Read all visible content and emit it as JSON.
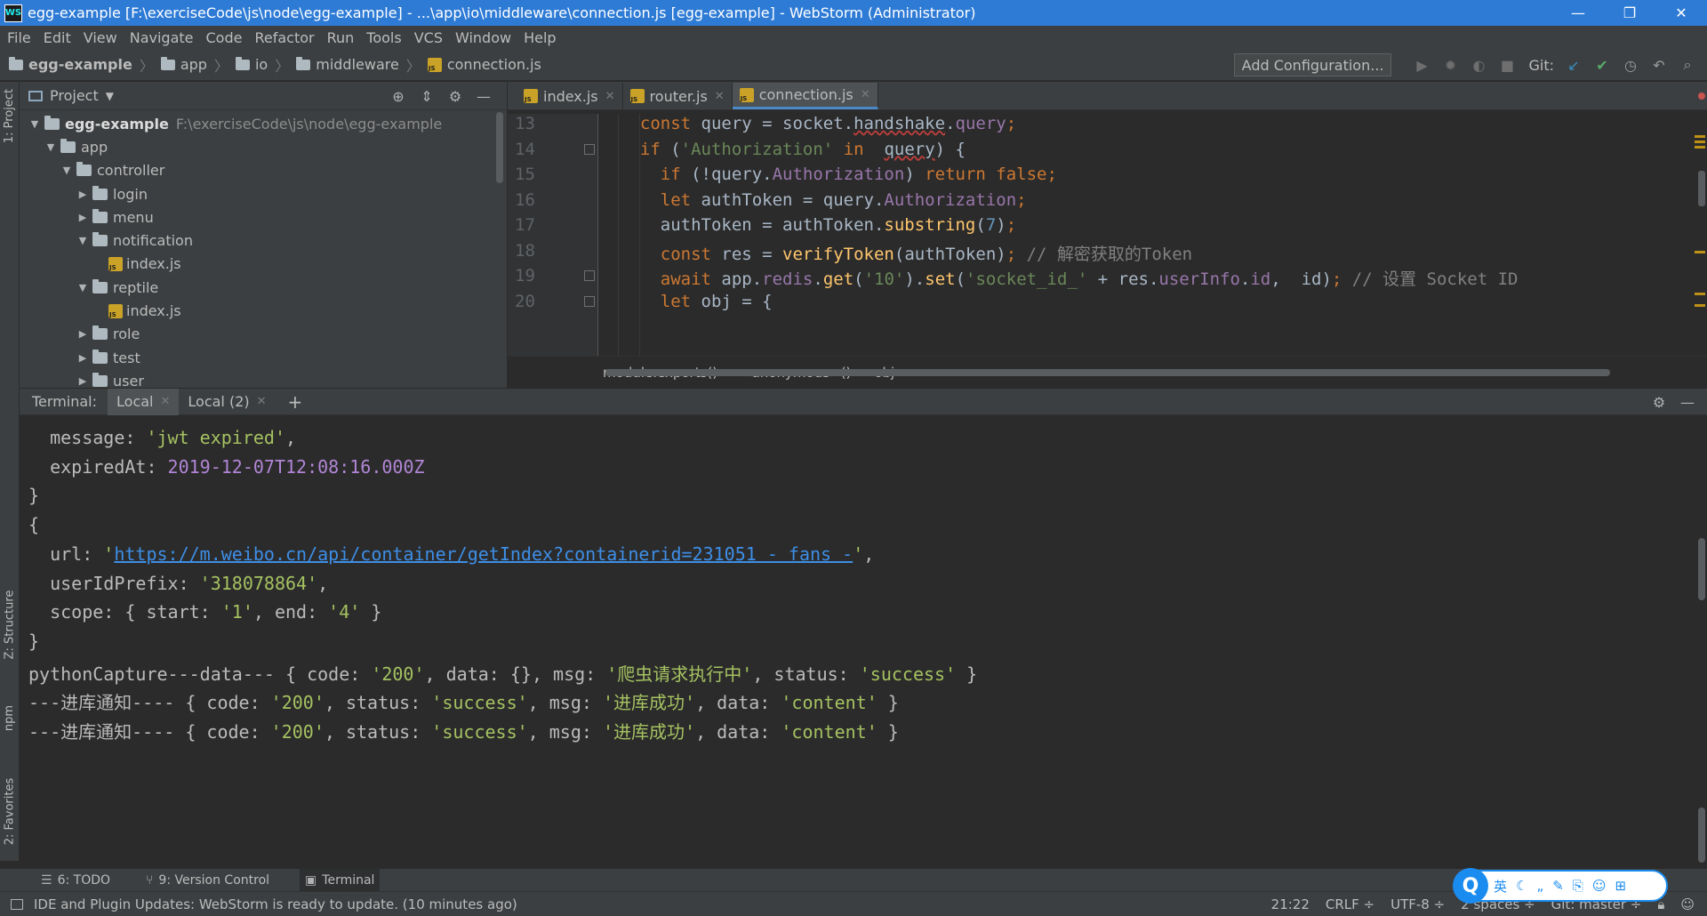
{
  "window": {
    "title": "egg-example [F:\\exerciseCode\\js\\node\\egg-example] - ...\\app\\io\\middleware\\connection.js [egg-example] - WebStorm (Administrator)",
    "app_icon": "WS",
    "minimize_icon": "—",
    "restore_icon": "❐",
    "close_icon": "✕"
  },
  "menu": [
    "File",
    "Edit",
    "View",
    "Navigate",
    "Code",
    "Refactor",
    "Run",
    "Tools",
    "VCS",
    "Window",
    "Help"
  ],
  "nav": {
    "breadcrumbs": [
      "egg-example",
      "app",
      "io",
      "middleware",
      "connection.js"
    ],
    "add_configuration": "Add Configuration...",
    "git_label": "Git:"
  },
  "left_strip": {
    "project": "1: Project",
    "structure": "Z: Structure",
    "npm": "npm",
    "favorites": "2: Favorites"
  },
  "project": {
    "header": "Project",
    "tree": [
      {
        "arrow": "▼",
        "type": "folder",
        "name": "egg-example",
        "path": "F:\\exerciseCode\\js\\node\\egg-example",
        "bold": true,
        "depth": 0
      },
      {
        "arrow": "▼",
        "type": "folder",
        "name": "app",
        "depth": 1
      },
      {
        "arrow": "▼",
        "type": "folder",
        "name": "controller",
        "depth": 2
      },
      {
        "arrow": "▶",
        "type": "folder",
        "name": "login",
        "depth": 3
      },
      {
        "arrow": "▶",
        "type": "folder",
        "name": "menu",
        "depth": 3
      },
      {
        "arrow": "▼",
        "type": "folder",
        "name": "notification",
        "depth": 3
      },
      {
        "arrow": "",
        "type": "js",
        "name": "index.js",
        "depth": 4
      },
      {
        "arrow": "▼",
        "type": "folder",
        "name": "reptile",
        "depth": 3
      },
      {
        "arrow": "",
        "type": "js",
        "name": "index.js",
        "depth": 4
      },
      {
        "arrow": "▶",
        "type": "folder",
        "name": "role",
        "depth": 3
      },
      {
        "arrow": "▶",
        "type": "folder",
        "name": "test",
        "depth": 3
      },
      {
        "arrow": "▶",
        "type": "folder",
        "name": "user",
        "depth": 3
      }
    ]
  },
  "editor": {
    "tabs": [
      {
        "name": "index.js",
        "active": false
      },
      {
        "name": "router.js",
        "active": false
      },
      {
        "name": "connection.js",
        "active": true
      }
    ],
    "line_numbers": [
      "13",
      "14",
      "15",
      "16",
      "17",
      "18",
      "19",
      "20"
    ],
    "breadcrumbs": [
      "module.exports()",
      "<anonymous>()",
      "obj"
    ]
  },
  "terminal": {
    "label": "Terminal:",
    "tabs": [
      {
        "name": "Local",
        "active": true
      },
      {
        "name": "Local (2)",
        "active": false
      }
    ],
    "add": "+"
  },
  "bottom_tools": [
    {
      "label": "6: TODO",
      "icon": "☰"
    },
    {
      "label": "9: Version Control",
      "icon": "⑂"
    },
    {
      "label": "Terminal",
      "icon": "▣",
      "active": true
    }
  ],
  "status": {
    "message": "IDE and Plugin Updates: WebStorm is ready to update. (10 minutes ago)",
    "position": "21:22",
    "line_sep": "CRLF ÷",
    "encoding": "UTF-8 ÷",
    "indent": "2 spaces ÷",
    "branch": "Git: master ÷"
  },
  "ime": {
    "logo": "Q",
    "items": [
      "英",
      "☾",
      "„",
      "✎",
      "⎘",
      "☺",
      "⊞"
    ]
  }
}
